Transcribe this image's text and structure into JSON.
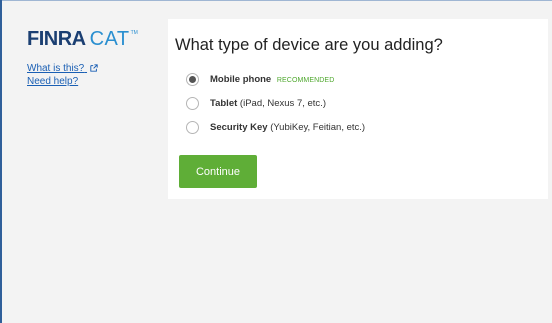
{
  "sidebar": {
    "logo": {
      "brand": "FINRA",
      "product": "CAT",
      "tm": "TM"
    },
    "links": [
      {
        "label": "What is this?",
        "external": true
      },
      {
        "label": "Need help?",
        "external": false
      }
    ]
  },
  "main": {
    "title": "What type of device are you adding?",
    "options": [
      {
        "label": "Mobile phone",
        "detail": "",
        "badge": "RECOMMENDED",
        "checked": true
      },
      {
        "label": "Tablet",
        "detail": " (iPad, Nexus 7, etc.)",
        "badge": "",
        "checked": false
      },
      {
        "label": "Security Key",
        "detail": " (YubiKey, Feitian, etc.)",
        "badge": "",
        "checked": false
      }
    ],
    "continue_label": "Continue"
  },
  "colors": {
    "brand_navy": "#1b3f72",
    "brand_blue": "#2a8fd0",
    "link": "#1a5fb4",
    "accent_green": "#5fae37",
    "badge_green": "#4fa82e"
  },
  "icons": {
    "external_link": "external-link-icon"
  }
}
